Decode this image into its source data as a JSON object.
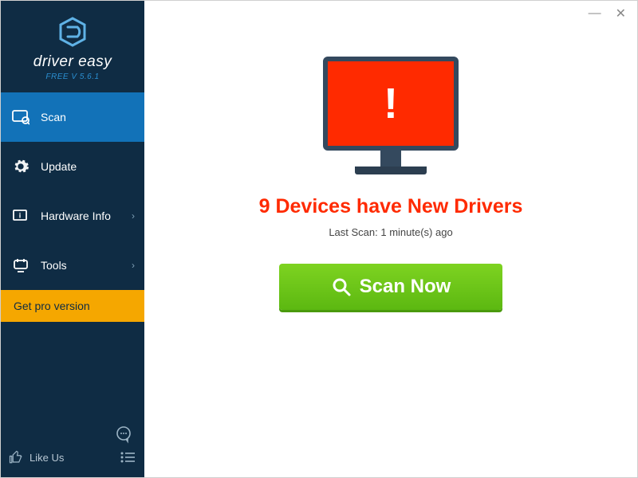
{
  "app": {
    "name": "driver easy",
    "version_label": "FREE V 5.6.1"
  },
  "sidebar": {
    "items": [
      {
        "label": "Scan",
        "icon": "scan",
        "active": true,
        "has_sub": false
      },
      {
        "label": "Update",
        "icon": "gear",
        "active": false,
        "has_sub": false
      },
      {
        "label": "Hardware Info",
        "icon": "hardware",
        "active": false,
        "has_sub": true
      },
      {
        "label": "Tools",
        "icon": "tools",
        "active": false,
        "has_sub": true
      }
    ],
    "pro_label": "Get pro version",
    "like_label": "Like Us"
  },
  "main": {
    "status": "9 Devices have New Drivers",
    "last_scan": "Last Scan: 1 minute(s) ago",
    "scan_button": "Scan Now"
  },
  "colors": {
    "sidebar_bg": "#0f2c44",
    "active_bg": "#1272b8",
    "pro_bg": "#f5a700",
    "alert_red": "#ff2a00",
    "scan_green": "#6ecb1c"
  }
}
